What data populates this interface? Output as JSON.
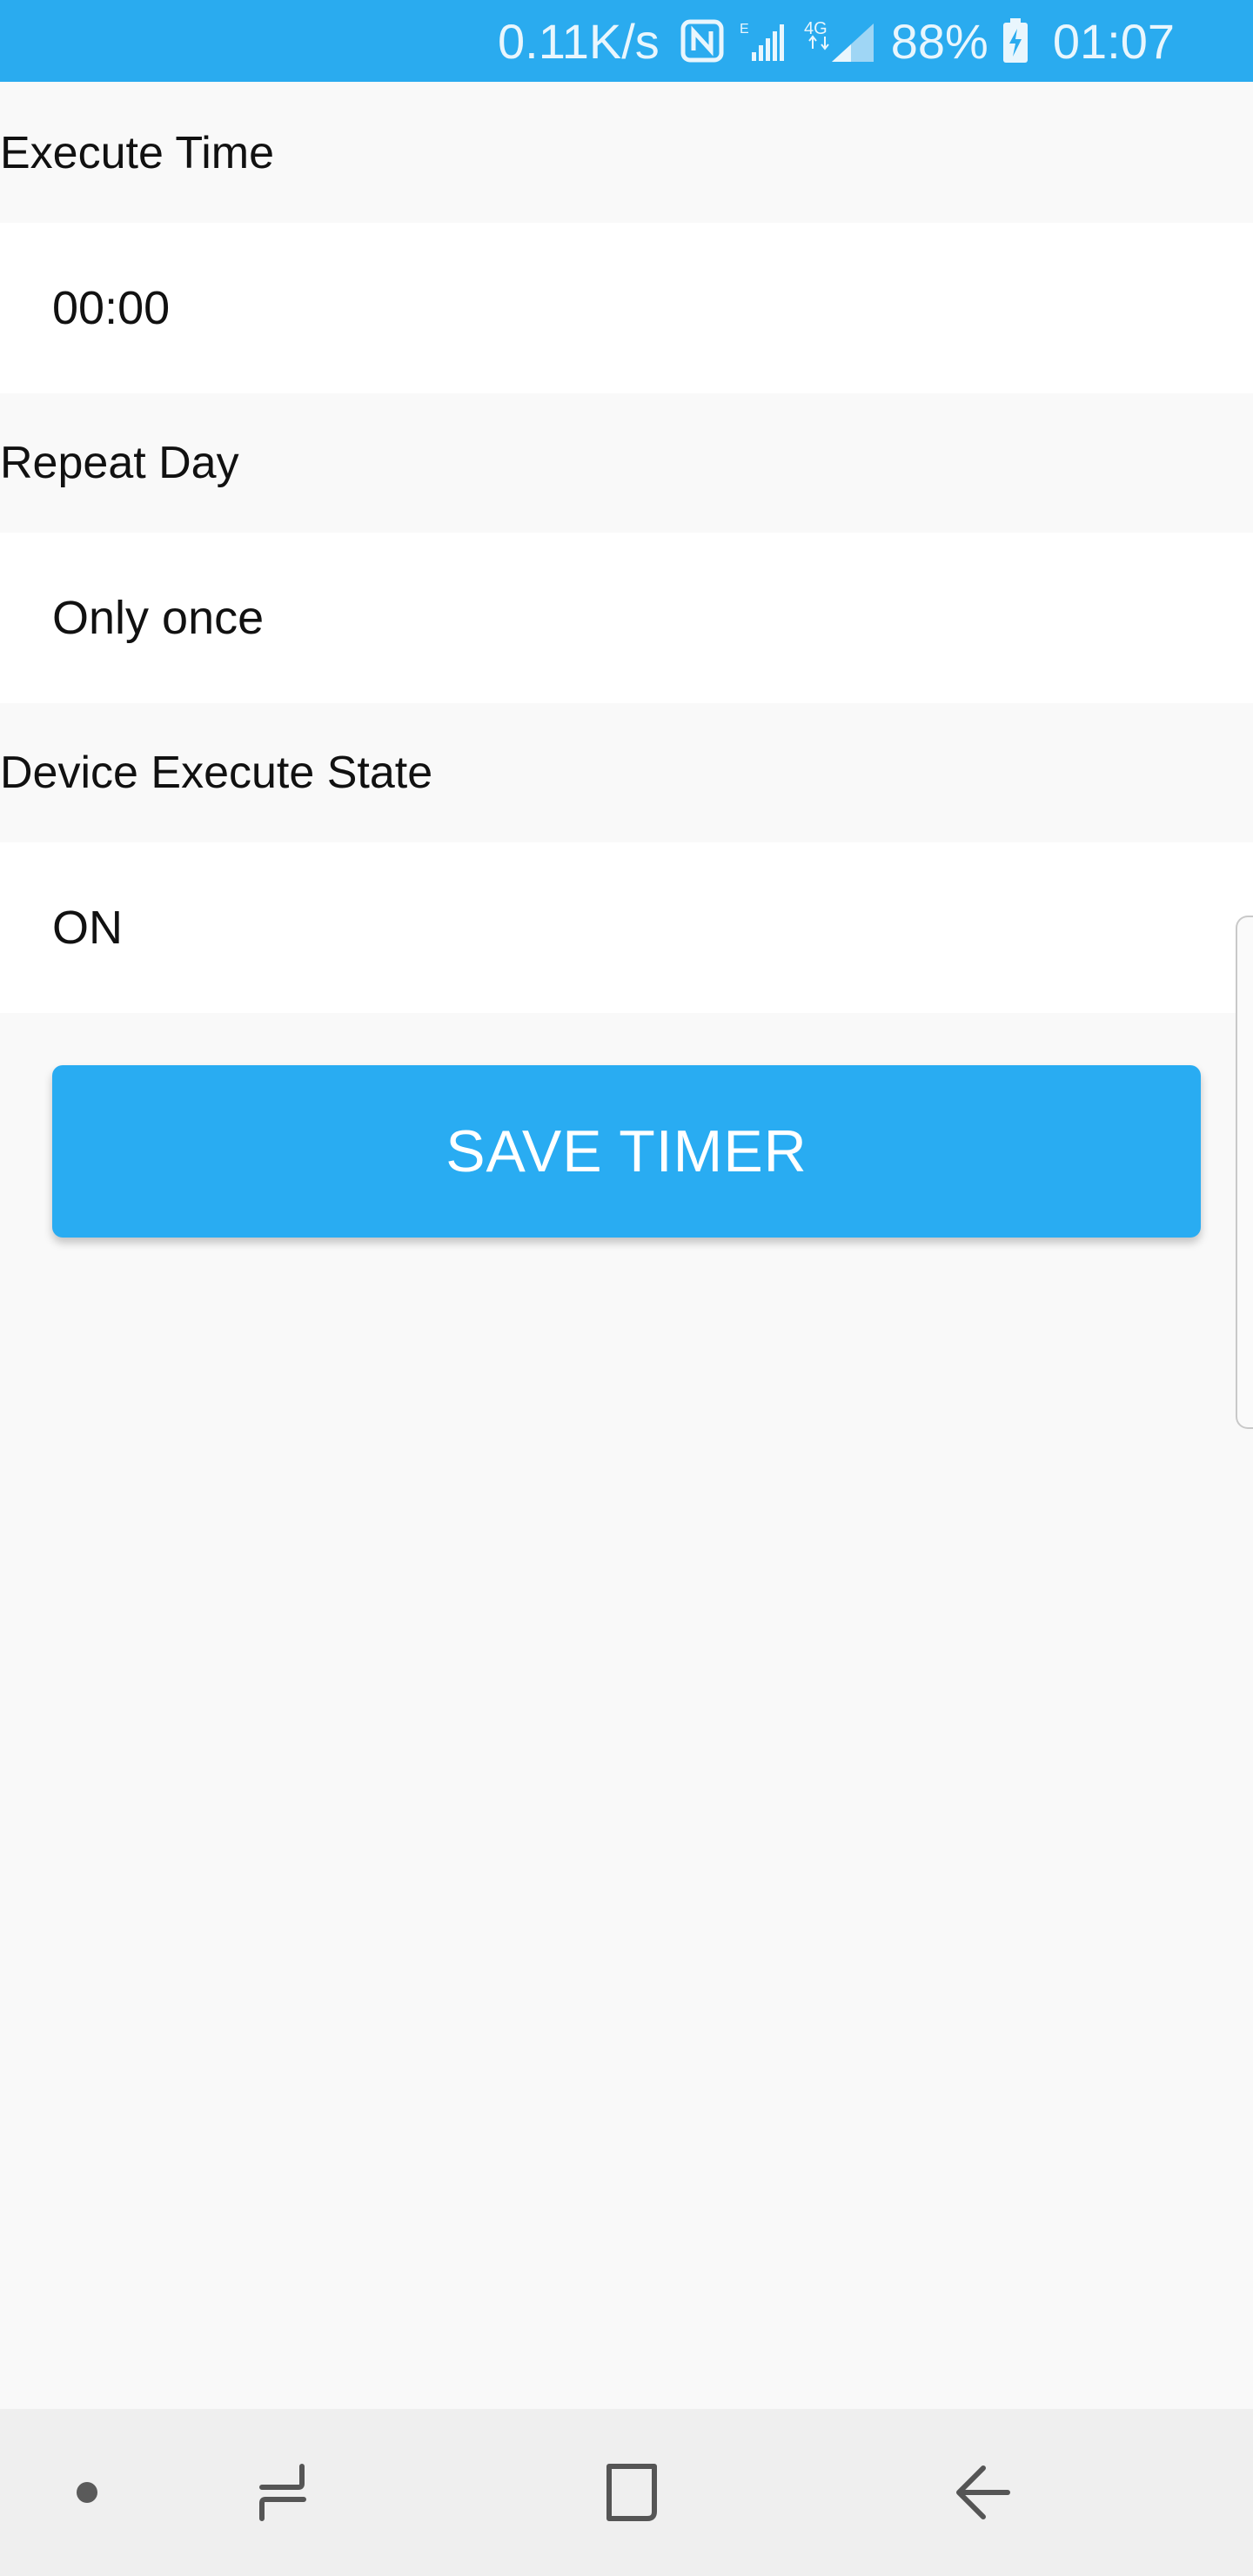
{
  "status_bar": {
    "net_speed": "0.11K/s",
    "battery_percent": "88%",
    "time": "01:07",
    "icons": [
      "nfc-icon",
      "signal-e-icon",
      "signal-4g-icon",
      "battery-charging-icon"
    ],
    "background_color": "#2aabef"
  },
  "form": {
    "execute_time": {
      "label": "Execute Time",
      "value": "00:00"
    },
    "repeat_day": {
      "label": "Repeat Day",
      "value": "Only once"
    },
    "device_execute_state": {
      "label": "Device Execute State",
      "value": "ON"
    }
  },
  "save_button": {
    "label": "SAVE TIMER",
    "color": "#29acf2"
  },
  "nav_bar": {
    "icons": [
      "dot-icon",
      "recent-apps-icon",
      "home-icon",
      "back-icon"
    ]
  }
}
